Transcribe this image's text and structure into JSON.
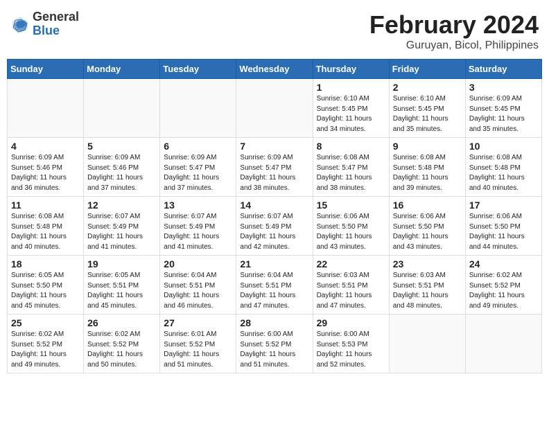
{
  "header": {
    "logo_general": "General",
    "logo_blue": "Blue",
    "month_year": "February 2024",
    "location": "Guruyan, Bicol, Philippines"
  },
  "weekdays": [
    "Sunday",
    "Monday",
    "Tuesday",
    "Wednesday",
    "Thursday",
    "Friday",
    "Saturday"
  ],
  "weeks": [
    [
      {
        "day": "",
        "info": ""
      },
      {
        "day": "",
        "info": ""
      },
      {
        "day": "",
        "info": ""
      },
      {
        "day": "",
        "info": ""
      },
      {
        "day": "1",
        "info": "Sunrise: 6:10 AM\nSunset: 5:45 PM\nDaylight: 11 hours\nand 34 minutes."
      },
      {
        "day": "2",
        "info": "Sunrise: 6:10 AM\nSunset: 5:45 PM\nDaylight: 11 hours\nand 35 minutes."
      },
      {
        "day": "3",
        "info": "Sunrise: 6:09 AM\nSunset: 5:45 PM\nDaylight: 11 hours\nand 35 minutes."
      }
    ],
    [
      {
        "day": "4",
        "info": "Sunrise: 6:09 AM\nSunset: 5:46 PM\nDaylight: 11 hours\nand 36 minutes."
      },
      {
        "day": "5",
        "info": "Sunrise: 6:09 AM\nSunset: 5:46 PM\nDaylight: 11 hours\nand 37 minutes."
      },
      {
        "day": "6",
        "info": "Sunrise: 6:09 AM\nSunset: 5:47 PM\nDaylight: 11 hours\nand 37 minutes."
      },
      {
        "day": "7",
        "info": "Sunrise: 6:09 AM\nSunset: 5:47 PM\nDaylight: 11 hours\nand 38 minutes."
      },
      {
        "day": "8",
        "info": "Sunrise: 6:08 AM\nSunset: 5:47 PM\nDaylight: 11 hours\nand 38 minutes."
      },
      {
        "day": "9",
        "info": "Sunrise: 6:08 AM\nSunset: 5:48 PM\nDaylight: 11 hours\nand 39 minutes."
      },
      {
        "day": "10",
        "info": "Sunrise: 6:08 AM\nSunset: 5:48 PM\nDaylight: 11 hours\nand 40 minutes."
      }
    ],
    [
      {
        "day": "11",
        "info": "Sunrise: 6:08 AM\nSunset: 5:48 PM\nDaylight: 11 hours\nand 40 minutes."
      },
      {
        "day": "12",
        "info": "Sunrise: 6:07 AM\nSunset: 5:49 PM\nDaylight: 11 hours\nand 41 minutes."
      },
      {
        "day": "13",
        "info": "Sunrise: 6:07 AM\nSunset: 5:49 PM\nDaylight: 11 hours\nand 41 minutes."
      },
      {
        "day": "14",
        "info": "Sunrise: 6:07 AM\nSunset: 5:49 PM\nDaylight: 11 hours\nand 42 minutes."
      },
      {
        "day": "15",
        "info": "Sunrise: 6:06 AM\nSunset: 5:50 PM\nDaylight: 11 hours\nand 43 minutes."
      },
      {
        "day": "16",
        "info": "Sunrise: 6:06 AM\nSunset: 5:50 PM\nDaylight: 11 hours\nand 43 minutes."
      },
      {
        "day": "17",
        "info": "Sunrise: 6:06 AM\nSunset: 5:50 PM\nDaylight: 11 hours\nand 44 minutes."
      }
    ],
    [
      {
        "day": "18",
        "info": "Sunrise: 6:05 AM\nSunset: 5:50 PM\nDaylight: 11 hours\nand 45 minutes."
      },
      {
        "day": "19",
        "info": "Sunrise: 6:05 AM\nSunset: 5:51 PM\nDaylight: 11 hours\nand 45 minutes."
      },
      {
        "day": "20",
        "info": "Sunrise: 6:04 AM\nSunset: 5:51 PM\nDaylight: 11 hours\nand 46 minutes."
      },
      {
        "day": "21",
        "info": "Sunrise: 6:04 AM\nSunset: 5:51 PM\nDaylight: 11 hours\nand 47 minutes."
      },
      {
        "day": "22",
        "info": "Sunrise: 6:03 AM\nSunset: 5:51 PM\nDaylight: 11 hours\nand 47 minutes."
      },
      {
        "day": "23",
        "info": "Sunrise: 6:03 AM\nSunset: 5:51 PM\nDaylight: 11 hours\nand 48 minutes."
      },
      {
        "day": "24",
        "info": "Sunrise: 6:02 AM\nSunset: 5:52 PM\nDaylight: 11 hours\nand 49 minutes."
      }
    ],
    [
      {
        "day": "25",
        "info": "Sunrise: 6:02 AM\nSunset: 5:52 PM\nDaylight: 11 hours\nand 49 minutes."
      },
      {
        "day": "26",
        "info": "Sunrise: 6:02 AM\nSunset: 5:52 PM\nDaylight: 11 hours\nand 50 minutes."
      },
      {
        "day": "27",
        "info": "Sunrise: 6:01 AM\nSunset: 5:52 PM\nDaylight: 11 hours\nand 51 minutes."
      },
      {
        "day": "28",
        "info": "Sunrise: 6:00 AM\nSunset: 5:52 PM\nDaylight: 11 hours\nand 51 minutes."
      },
      {
        "day": "29",
        "info": "Sunrise: 6:00 AM\nSunset: 5:53 PM\nDaylight: 11 hours\nand 52 minutes."
      },
      {
        "day": "",
        "info": ""
      },
      {
        "day": "",
        "info": ""
      }
    ]
  ]
}
